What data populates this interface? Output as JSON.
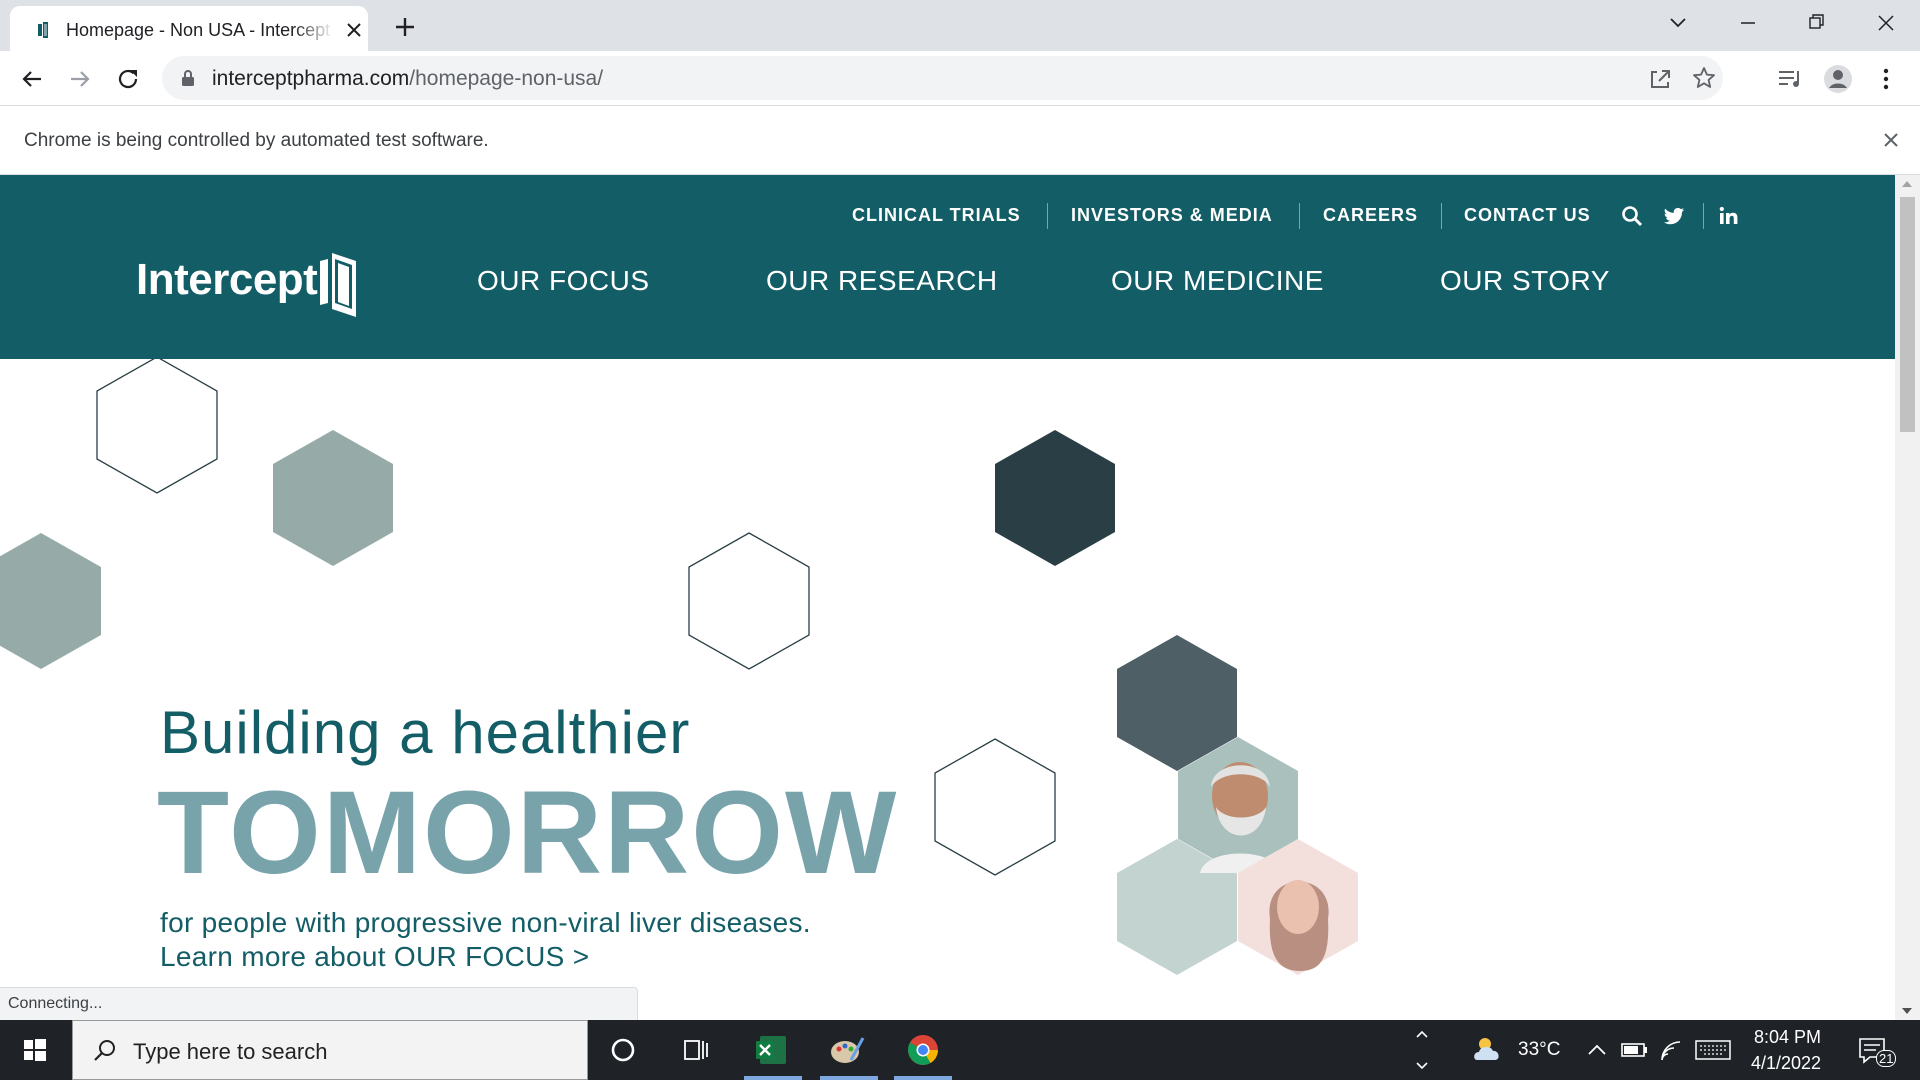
{
  "browser": {
    "tab_title": "Homepage - Non USA - Intercept",
    "url_host": "interceptpharma.com",
    "url_path": "/homepage-non-usa/",
    "infobar_message": "Chrome is being controlled by automated test software.",
    "status_text": "Connecting..."
  },
  "site": {
    "utility_nav": [
      "CLINICAL TRIALS",
      "INVESTORS & MEDIA",
      "CAREERS",
      "CONTACT US"
    ],
    "logo_text": "Intercept",
    "main_nav": [
      "OUR FOCUS",
      "OUR RESEARCH",
      "OUR MEDICINE",
      "OUR STORY"
    ],
    "colors": {
      "header_bg": "#135d66",
      "hero_text": "#135d66",
      "hero_accent": "#78a3ab",
      "hex_dark": "#2a3e45",
      "hex_slate": "#4f5f66",
      "hex_sage": "#96aba7",
      "hex_pale": "#c3d3d0"
    }
  },
  "hero": {
    "line1": "Building a healthier",
    "line2": "TOMORROW",
    "line3": "for people with progressive non-viral liver diseases.",
    "line4": "Learn more about OUR FOCUS >"
  },
  "taskbar": {
    "search_placeholder": "Type here to search",
    "weather": "33°C",
    "time": "8:04 PM",
    "date": "4/1/2022",
    "notifications": "21"
  }
}
